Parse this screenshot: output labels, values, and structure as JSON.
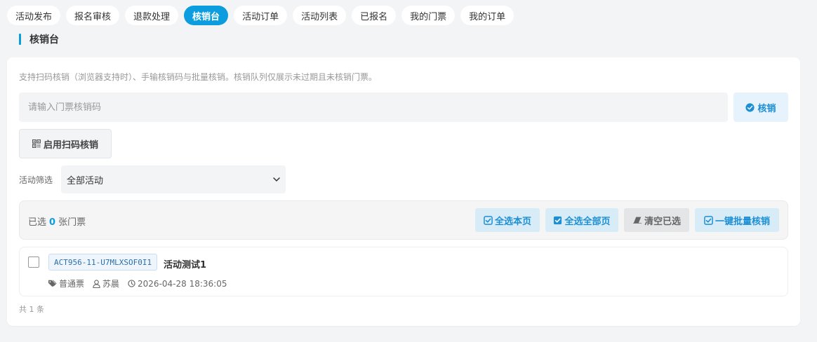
{
  "tabs": [
    {
      "label": "活动发布",
      "active": false
    },
    {
      "label": "报名审核",
      "active": false
    },
    {
      "label": "退款处理",
      "active": false
    },
    {
      "label": "核销台",
      "active": true
    },
    {
      "label": "活动订单",
      "active": false
    },
    {
      "label": "活动列表",
      "active": false
    },
    {
      "label": "已报名",
      "active": false
    },
    {
      "label": "我的门票",
      "active": false
    },
    {
      "label": "我的订单",
      "active": false
    }
  ],
  "section_title": "核销台",
  "description": "支持扫码核销（浏览器支持时）、手输核销码与批量核销。核销队列仅展示未过期且未核销门票。",
  "code_input": {
    "placeholder": "请输入门票核销码",
    "value": ""
  },
  "verify_button": {
    "label": "核销",
    "icon": "check-circle-icon"
  },
  "scan_button": {
    "label": "启用扫码核销",
    "icon": "qrcode-icon"
  },
  "filter": {
    "label": "活动筛选",
    "selected": "全部活动"
  },
  "selection": {
    "prefix": "已选",
    "count": "0",
    "suffix": "张门票"
  },
  "toolbar_buttons": [
    {
      "label": "全选本页",
      "icon": "check-square-icon"
    },
    {
      "label": "全选全部页",
      "icon": "check-square-filled-icon"
    },
    {
      "label": "清空已选",
      "icon": "eraser-icon"
    },
    {
      "label": "一键批量核销",
      "icon": "check-square-icon"
    }
  ],
  "tickets": [
    {
      "code": "ACT956-11-U7MLXSOF0I1",
      "activity": "活动测试1",
      "type": "普通票",
      "holder": "苏晨",
      "time": "2026-04-28 18:36:05",
      "checked": false
    }
  ],
  "total_text": "共 1 条",
  "colors": {
    "accent": "#0b9dde",
    "page_bg": "#f3f4f6",
    "button_blue_bg": "#d8ecf8",
    "button_blue_text": "#1c8fd4",
    "button_gray_bg": "#e4e5e7"
  }
}
